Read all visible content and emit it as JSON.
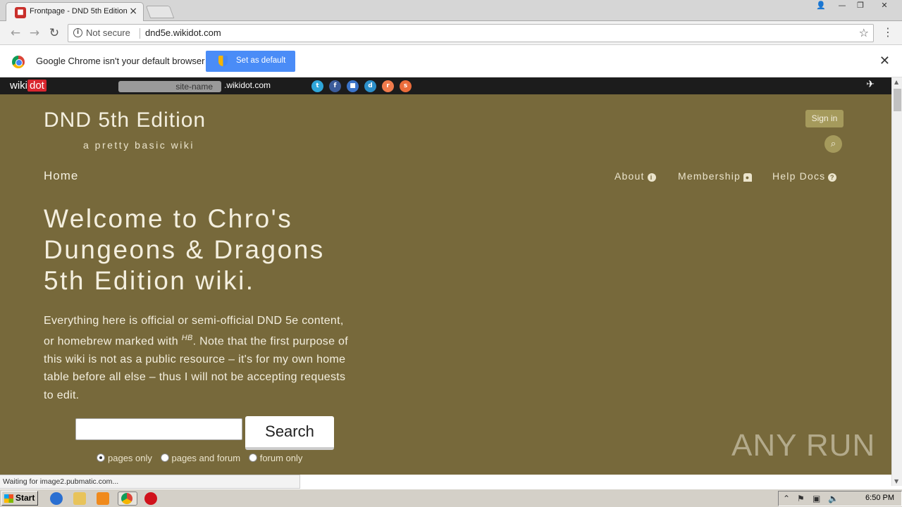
{
  "browser": {
    "tab_title": "Frontpage - DND 5th Edition",
    "security_label": "Not secure",
    "url": "dnd5e.wikidot.com",
    "infobar_message": "Google Chrome isn't your default browser",
    "set_default_label": "Set as default"
  },
  "wikidot_bar": {
    "logo_wiki": "wiki",
    "logo_dot": "dot",
    "site_field_placeholder": "site-name",
    "site_suffix": ".wikidot.com",
    "social_icons": [
      "twitter-icon",
      "facebook-icon",
      "delicious-icon",
      "digg-icon",
      "reddit-icon",
      "stumbleupon-icon"
    ]
  },
  "site": {
    "title": "DND 5th Edition",
    "subtitle": "a pretty basic wiki",
    "sign_in": "Sign in",
    "nav": {
      "home": "Home",
      "about": "About",
      "membership": "Membership",
      "help_docs": "Help Docs"
    },
    "headline": "Welcome to Chro's Dungeons & Dragons 5th Edition wiki.",
    "intro_before": "Everything here is official or semi-official DND 5e content, or homebrew marked with ",
    "intro_sup": "HB",
    "intro_after": ". Note that the first purpose of this wiki is not as a public resource – it's for my own home table before all else – thus I will not be accepting requests to edit.",
    "search_button": "Search",
    "search_options": [
      "pages only",
      "pages and forum",
      "forum only"
    ],
    "search_selected": "pages only"
  },
  "status_text": "Waiting for image2.pubmatic.com...",
  "watermark": "ANY RUN",
  "taskbar": {
    "start": "Start",
    "clock": "6:50 PM"
  },
  "colors": {
    "page_bg": "#77693b",
    "accent_button": "#a59a5c",
    "chrome_blue": "#4a8cf7",
    "wikidot_red": "#d9262f"
  }
}
